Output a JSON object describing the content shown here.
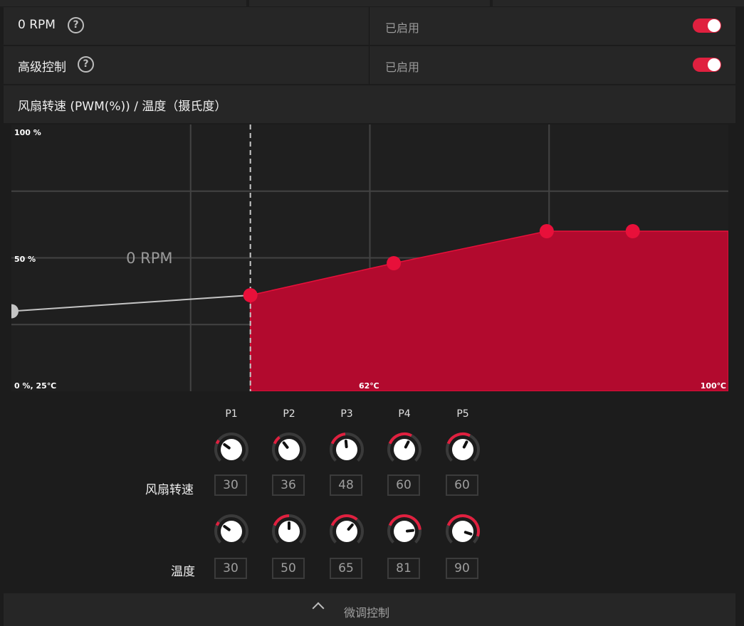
{
  "settings": {
    "zero_rpm": {
      "label": "0 RPM",
      "help": "?",
      "state": "已启用",
      "enabled": true
    },
    "advanced": {
      "label": "高级控制",
      "help": "?",
      "state": "已启用",
      "enabled": true
    }
  },
  "chart_title": "风扇转速 (PWM(%)) / 温度（摄氏度）",
  "chart_data": {
    "type": "area",
    "title": "风扇转速 (PWM(%)) / 温度（摄氏度）",
    "ylim": [
      0,
      100
    ],
    "y_tick_labels": [
      "100 %",
      "50 %",
      "0 %, 25℃"
    ],
    "x_tick_labels": [
      "62℃",
      "100℃"
    ],
    "zero_rpm_label": "0 RPM",
    "zero_rpm_threshold": 50,
    "zero_rpm_points": [
      [
        25,
        30
      ],
      [
        50,
        36
      ]
    ],
    "series": [
      {
        "points": [
          [
            50,
            36
          ],
          [
            65,
            48
          ],
          [
            81,
            60
          ],
          [
            90,
            60
          ],
          [
            100,
            60
          ]
        ]
      }
    ],
    "colors": {
      "fill": "#b20a2e",
      "point": "#e8103a",
      "zero_rpm_line": "#c4c4c4"
    },
    "grid": true
  },
  "points_header": [
    "P1",
    "P2",
    "P3",
    "P4",
    "P5"
  ],
  "fan_speed": {
    "label": "风扇转速",
    "values": [
      "30",
      "36",
      "48",
      "60",
      "60"
    ],
    "levels": [
      0.3,
      0.36,
      0.48,
      0.6,
      0.6
    ]
  },
  "temperature": {
    "label": "温度",
    "values": [
      "30",
      "50",
      "65",
      "81",
      "90"
    ],
    "levels": [
      0.3,
      0.5,
      0.65,
      0.81,
      0.9
    ]
  },
  "footer": {
    "label": "微调控制"
  },
  "accent": "#e0203f"
}
